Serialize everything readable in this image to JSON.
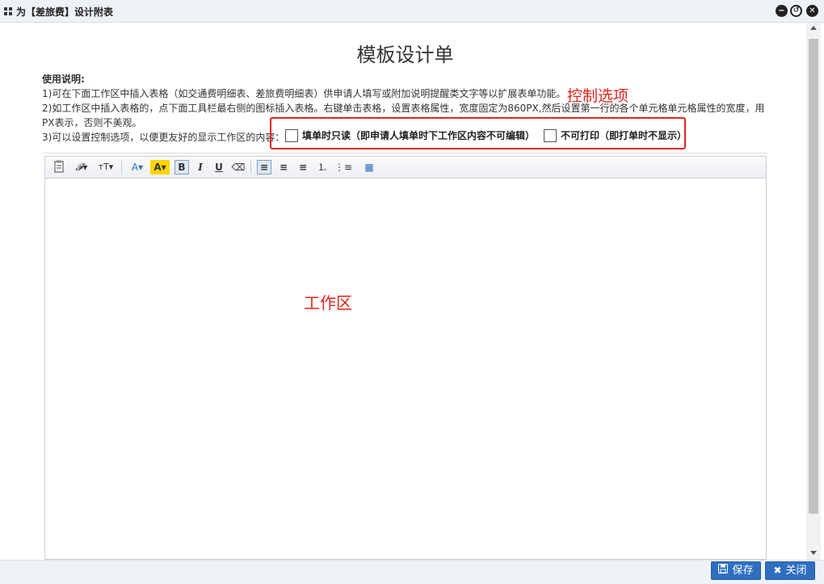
{
  "window": {
    "title": "为【差旅费】设计附表",
    "minimize_glyph": "−",
    "restore_glyph": "↺",
    "close_glyph": "✕"
  },
  "page": {
    "title": "模板设计单",
    "instructions": {
      "heading": "使用说明:",
      "line1": "1)可在下面工作区中插入表格（如交通费明细表、差旅费明细表）供申请人填写或附加说明提醒类文字等以扩展表单功能。",
      "line2a": "2)如工作区中插入表格的，点下面工具栏最右侧的图标插入表格。右键单击表格，设置表格属性，宽度固定为860PX,然后设置第一行的各个单元格单元格属性的宽度，用",
      "line2b": "PX表示，否则不美观。",
      "line3": "3)可以设置控制选项，以便更友好的显示工作区的内容："
    },
    "annotations": {
      "control_options": "控制选项",
      "work_area": "工作区"
    },
    "options": [
      {
        "label": "填单时只读（即申请人填单时下工作区内容不可编辑）",
        "checked": false
      },
      {
        "label": "不可打印（即打单时不显示）",
        "checked": false
      }
    ]
  },
  "toolbar": {
    "buttons": [
      {
        "name": "paste-icon",
        "glyph": "📋"
      },
      {
        "name": "font-family-icon",
        "glyph": "𝓕▾"
      },
      {
        "name": "font-size-icon",
        "glyph": "тT▾"
      },
      {
        "name": "font-color-icon",
        "glyph": "A▾"
      },
      {
        "name": "highlight-icon",
        "glyph": "A▾"
      },
      {
        "name": "bold-icon",
        "glyph": "B"
      },
      {
        "name": "italic-icon",
        "glyph": "I"
      },
      {
        "name": "underline-icon",
        "glyph": "U"
      },
      {
        "name": "eraser-icon",
        "glyph": "⌫"
      },
      {
        "name": "align-left-icon",
        "glyph": "≡"
      },
      {
        "name": "align-center-icon",
        "glyph": "≡"
      },
      {
        "name": "align-right-icon",
        "glyph": "≡"
      },
      {
        "name": "ordered-list-icon",
        "glyph": "⒈"
      },
      {
        "name": "unordered-list-icon",
        "glyph": "⋮≡"
      },
      {
        "name": "insert-table-icon",
        "glyph": "▦"
      }
    ]
  },
  "footer": {
    "save_label": "保存",
    "close_label": "关闭"
  },
  "colors": {
    "accent_button": "#2f6fc0",
    "annotation_red": "#e1251b",
    "titlebar_bg": "#eef2f7"
  }
}
